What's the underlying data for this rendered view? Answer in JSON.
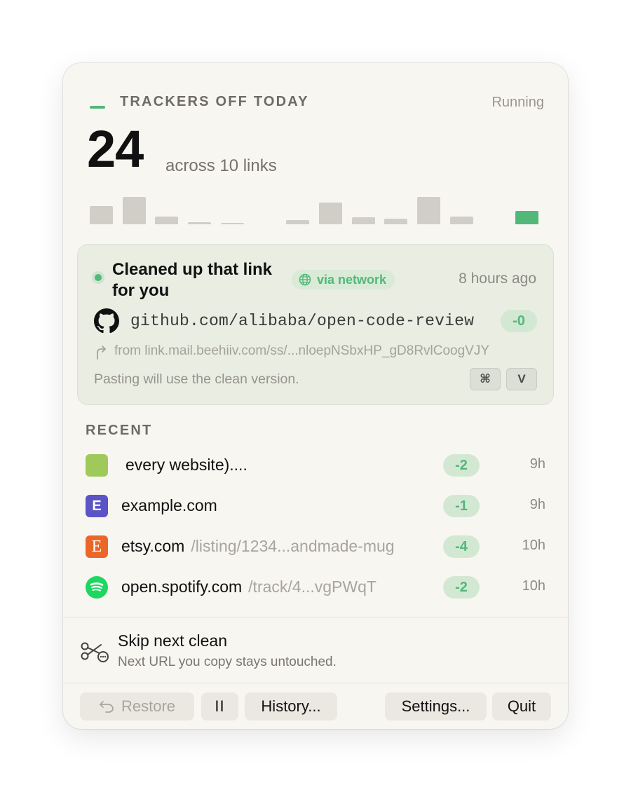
{
  "header": {
    "title": "TRACKERS OFF TODAY",
    "status": "Running",
    "count": "24",
    "subtitle": "across 10 links"
  },
  "activity_bars": [
    0.6,
    0.88,
    0.25,
    0.06,
    0.04,
    0,
    0.13,
    0.7,
    0.22,
    0.19,
    0.88,
    0.25,
    0,
    0.44
  ],
  "accent_color": "#52b87a",
  "latest": {
    "title": "Cleaned up that link for you",
    "via": "via network",
    "via_icon": "globe-icon",
    "time": "8 hours ago",
    "icon": "github-icon",
    "url": "github.com/alibaba/open-code-review",
    "delta": "-0",
    "from": "from link.mail.beehiiv.com/ss/...nloepNSbxHP_gD8RvlCoogVJY",
    "note": "Pasting will use the clean version.",
    "keys": [
      "⌘",
      "V"
    ]
  },
  "recent": {
    "title": "RECENT",
    "items": [
      {
        "icon_letter": "",
        "icon_color": "#9fca5b",
        "host": "every website)....",
        "path": "",
        "delta": "-2",
        "age": "9h"
      },
      {
        "icon_letter": "E",
        "icon_color": "#5b54c4",
        "host": "example.com",
        "path": "",
        "delta": "-1",
        "age": "9h"
      },
      {
        "icon_letter": "E",
        "icon_color": "#ec6627",
        "host": "etsy.com",
        "path": "/listing/1234...andmade-mug",
        "delta": "-4",
        "age": "10h"
      },
      {
        "icon_letter": "",
        "icon_color": "#1ed760",
        "host": "open.spotify.com",
        "path": "/track/4...vgPWqT",
        "delta": "-2",
        "age": "10h"
      }
    ]
  },
  "skip": {
    "title": "Skip next clean",
    "subtitle": "Next URL you copy stays untouched."
  },
  "buttons": {
    "restore": "Restore",
    "pause": "II",
    "history": "History...",
    "settings": "Settings...",
    "quit": "Quit"
  }
}
